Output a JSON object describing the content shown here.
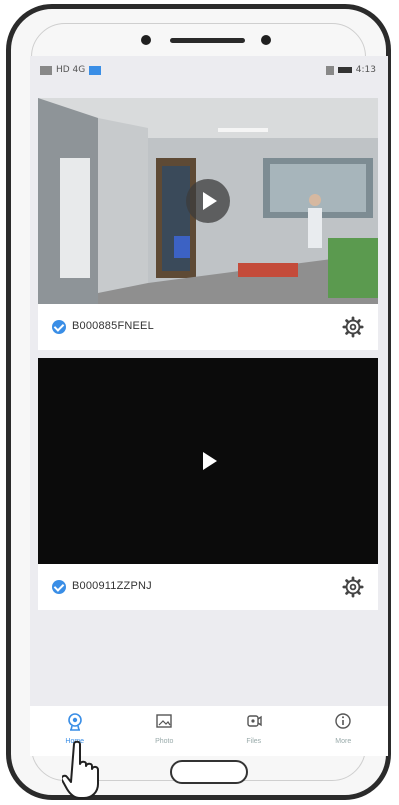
{
  "status_bar": {
    "time": "4:13",
    "left_text": "HD 4G"
  },
  "devices": [
    {
      "name": "B000885FNEEL",
      "selected": true
    },
    {
      "name": "B000911ZZPNJ",
      "selected": true
    }
  ],
  "tabs": [
    {
      "label": "Home",
      "icon": "camera-icon",
      "active": true
    },
    {
      "label": "Photo",
      "icon": "image-icon",
      "active": false
    },
    {
      "label": "Files",
      "icon": "video-file-icon",
      "active": false
    },
    {
      "label": "More",
      "icon": "info-icon",
      "active": false
    }
  ],
  "colors": {
    "accent": "#3a8ee6",
    "video_bg": "#0b0b0b",
    "screen_bg": "#ececf0"
  }
}
